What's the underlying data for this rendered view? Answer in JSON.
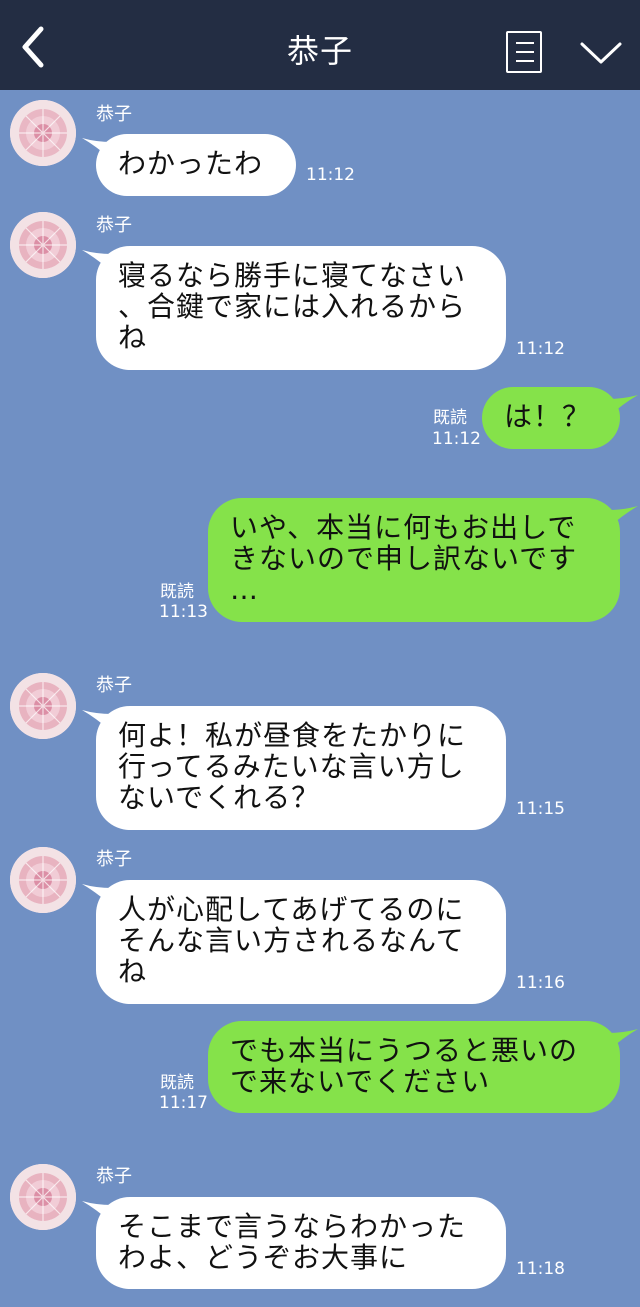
{
  "header": {
    "title": "恭子",
    "back_icon": "chevron-left-icon",
    "notes_icon": "notes-icon",
    "menu_icon": "chevron-down-icon"
  },
  "messages": [
    {
      "side": "in",
      "sender": "恭子",
      "text": "わかったわ",
      "time": "11:12"
    },
    {
      "side": "in",
      "sender": "恭子",
      "text": "寝るなら勝手に寝てなさい\n、合鍵で家には入れるから\nね",
      "time": "11:12"
    },
    {
      "side": "out",
      "read": "既読",
      "text": "は！？",
      "time": "11:12"
    },
    {
      "side": "out",
      "read": "既読",
      "text": "いや、本当に何もお出しで\nきないので申し訳ないです\n…",
      "time": "11:13"
    },
    {
      "side": "in",
      "sender": "恭子",
      "text": "何よ！私が昼食をたかりに\n行ってるみたいな言い方し\nないでくれる？",
      "time": "11:15"
    },
    {
      "side": "in",
      "sender": "恭子",
      "text": "人が心配してあげてるのに\nそんな言い方されるなんて\nね",
      "time": "11:16"
    },
    {
      "side": "out",
      "read": "既読",
      "text": "でも本当にうつると悪いの\nで来ないでください",
      "time": "11:17"
    },
    {
      "side": "in",
      "sender": "恭子",
      "text": "そこまで言うならわかった\nわよ、どうぞお大事に",
      "time": "11:18"
    }
  ],
  "colors": {
    "header_bg": "#232d43",
    "chat_bg": "#7090c4",
    "incoming_bubble": "#ffffff",
    "outgoing_bubble": "#85e24a"
  }
}
